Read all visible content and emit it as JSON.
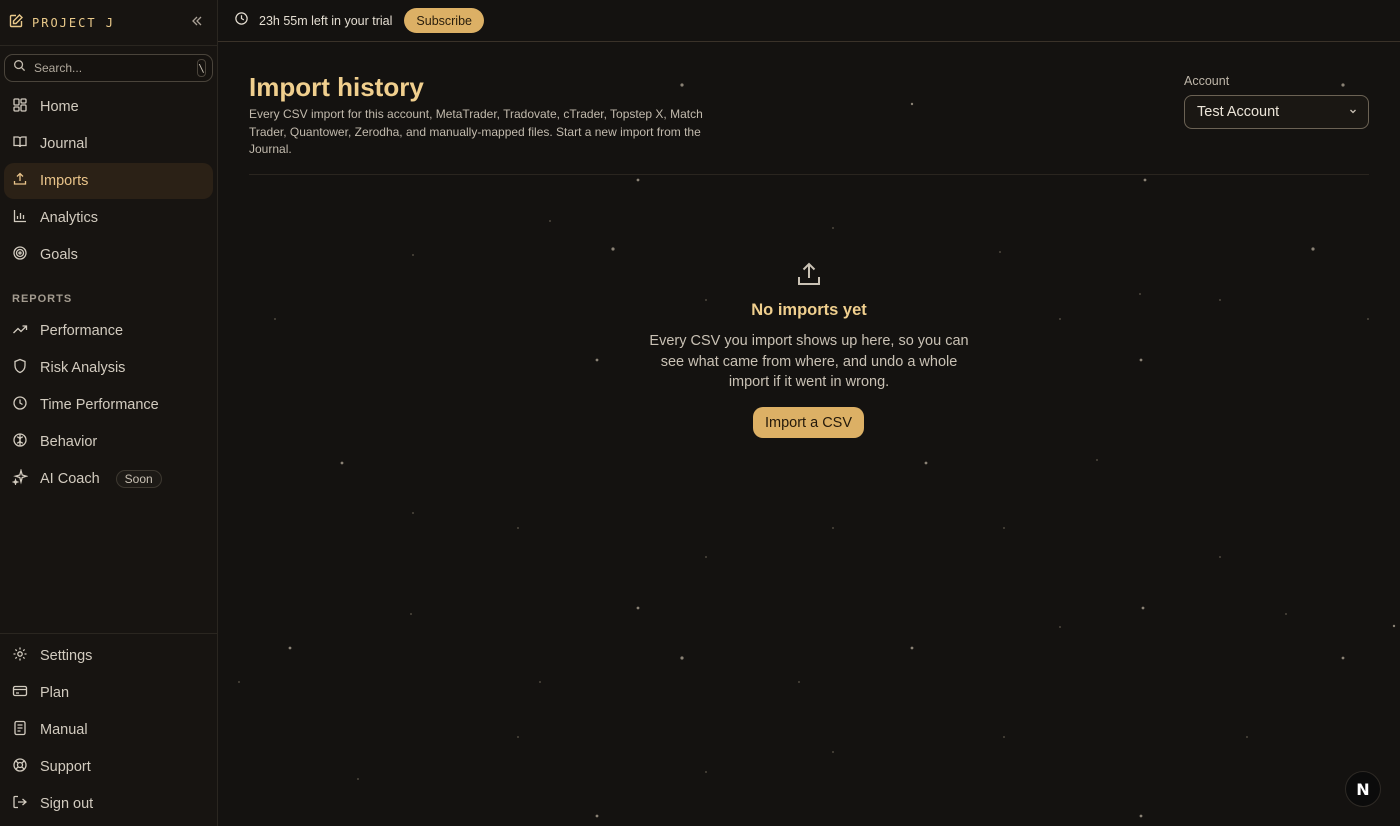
{
  "brand": {
    "name": "PROJECT J"
  },
  "search": {
    "placeholder": "Search...",
    "shortcut": "\\"
  },
  "nav": {
    "main": [
      {
        "label": "Home",
        "icon": "grid-icon"
      },
      {
        "label": "Journal",
        "icon": "book-icon"
      },
      {
        "label": "Imports",
        "icon": "upload-icon",
        "active": true
      },
      {
        "label": "Analytics",
        "icon": "bar-chart-icon"
      },
      {
        "label": "Goals",
        "icon": "target-icon"
      }
    ],
    "reports_label": "REPORTS",
    "reports": [
      {
        "label": "Performance",
        "icon": "trending-up-icon"
      },
      {
        "label": "Risk Analysis",
        "icon": "shield-icon"
      },
      {
        "label": "Time Performance",
        "icon": "clock-icon"
      },
      {
        "label": "Behavior",
        "icon": "brain-icon"
      },
      {
        "label": "AI Coach",
        "icon": "sparkle-icon",
        "badge": "Soon"
      }
    ],
    "bottom": [
      {
        "label": "Settings",
        "icon": "gear-icon"
      },
      {
        "label": "Plan",
        "icon": "credit-card-icon"
      },
      {
        "label": "Manual",
        "icon": "document-icon"
      },
      {
        "label": "Support",
        "icon": "lifebuoy-icon"
      },
      {
        "label": "Sign out",
        "icon": "sign-out-icon"
      }
    ]
  },
  "topbar": {
    "trial_text": "23h 55m left in your trial",
    "subscribe_label": "Subscribe"
  },
  "main": {
    "title": "Import history",
    "description": "Every CSV import for this account, MetaTrader, Tradovate, cTrader, Topstep X, Match Trader, Quantower, Zerodha, and manually-mapped files. Start a new import from the Journal.",
    "account_label": "Account",
    "account_value": "Test Account",
    "empty_title": "No imports yet",
    "empty_description": "Every CSV you import shows up here, so you can see what came from where, and undo a whole import if it went in wrong.",
    "import_button": "Import a CSV"
  },
  "floating_badge": "N",
  "colors": {
    "accent": "#dcb065",
    "title": "#f0cf8e",
    "background": "#141210"
  }
}
